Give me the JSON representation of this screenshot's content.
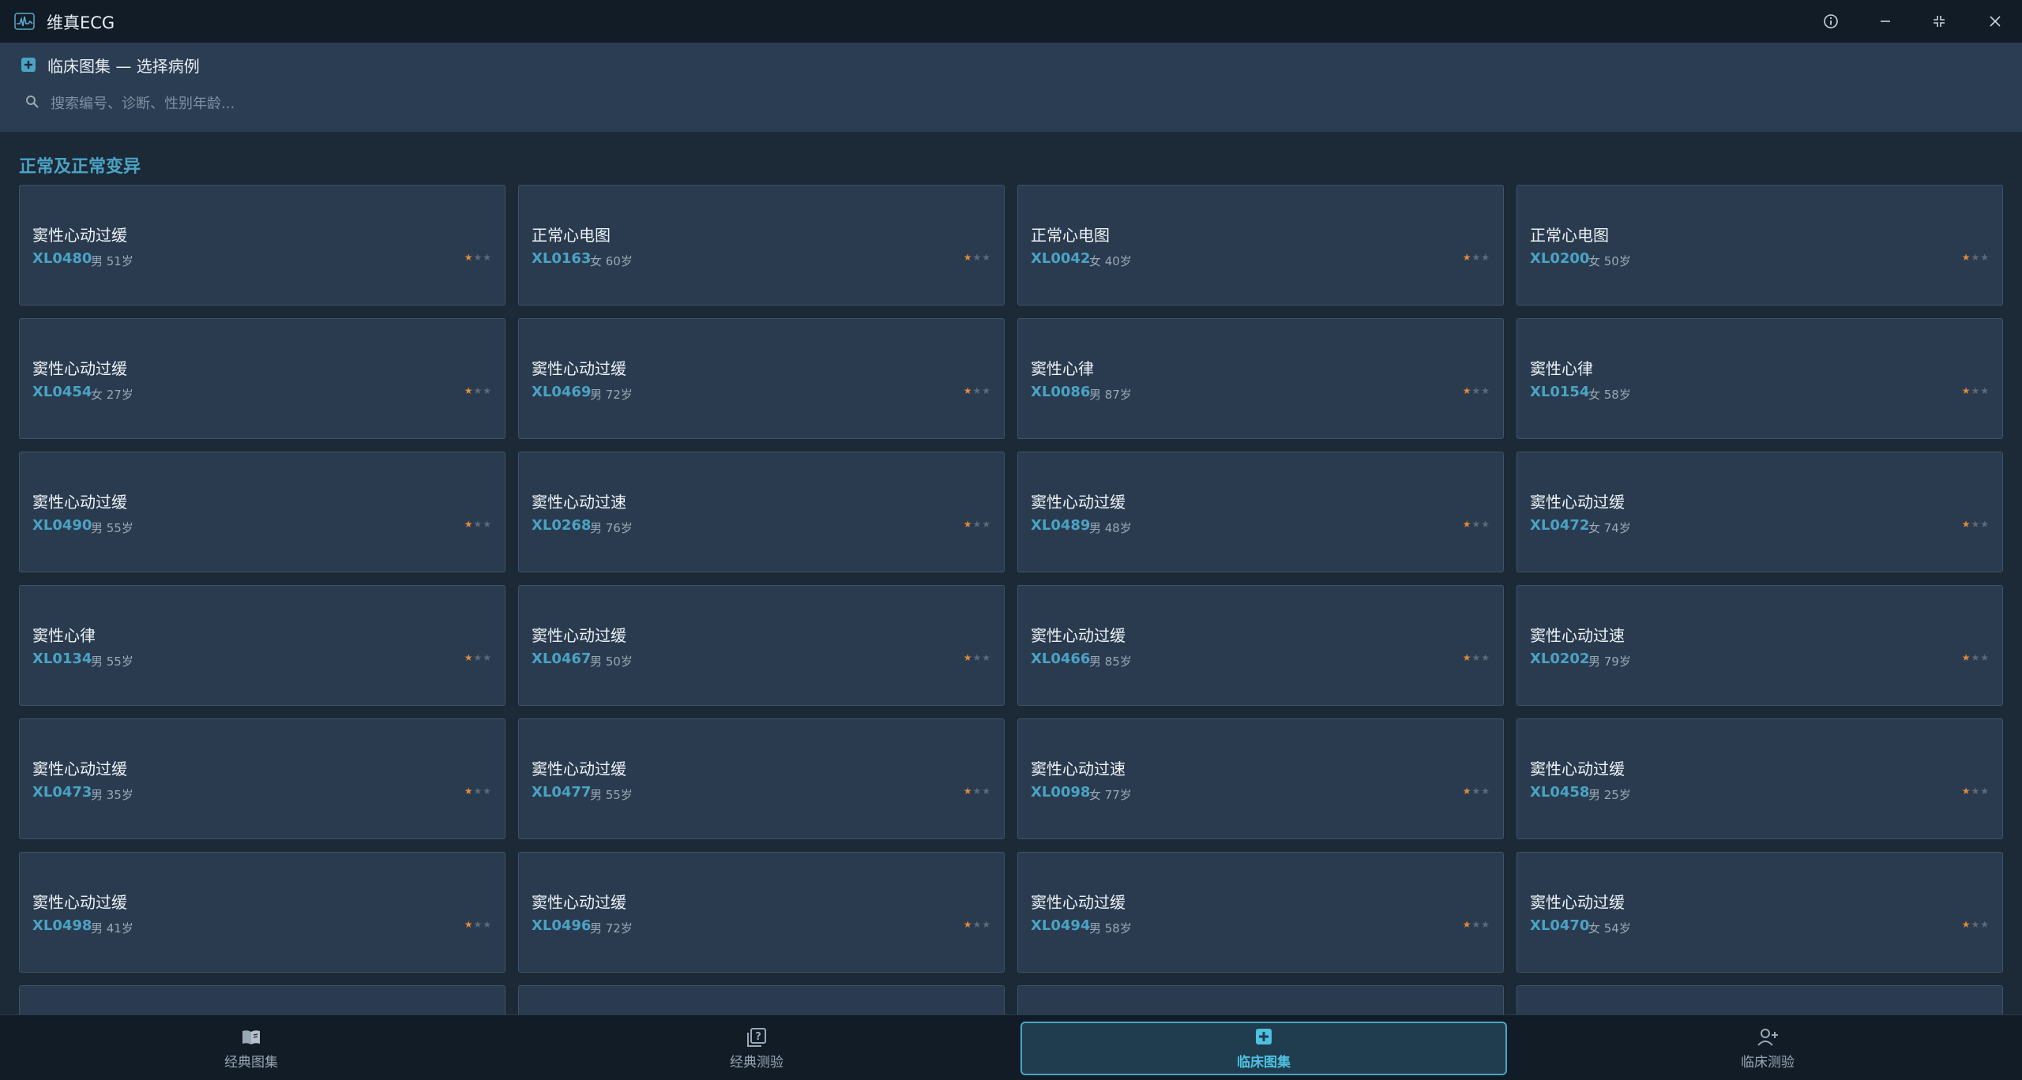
{
  "window": {
    "title": "维真ECG",
    "buttons": [
      "info-icon",
      "minimize-icon",
      "restore-icon",
      "close-icon"
    ]
  },
  "header": {
    "breadcrumb": "临床图集 — 选择病例",
    "search_placeholder": "搜索编号、诊断、性别年龄..."
  },
  "section": {
    "title": "正常及正常变异"
  },
  "cards": [
    {
      "title": "窦性心动过缓",
      "id": "XL0480",
      "meta": "男 51岁",
      "rating": 1
    },
    {
      "title": "正常心电图",
      "id": "XL0163",
      "meta": "女 60岁",
      "rating": 1
    },
    {
      "title": "正常心电图",
      "id": "XL0042",
      "meta": "女 40岁",
      "rating": 1
    },
    {
      "title": "正常心电图",
      "id": "XL0200",
      "meta": "女 50岁",
      "rating": 1
    },
    {
      "title": "窦性心动过缓",
      "id": "XL0454",
      "meta": "女 27岁",
      "rating": 1
    },
    {
      "title": "窦性心动过缓",
      "id": "XL0469",
      "meta": "男 72岁",
      "rating": 1
    },
    {
      "title": "窦性心律",
      "id": "XL0086",
      "meta": "男 87岁",
      "rating": 1
    },
    {
      "title": "窦性心律",
      "id": "XL0154",
      "meta": "女 58岁",
      "rating": 1
    },
    {
      "title": "窦性心动过缓",
      "id": "XL0490",
      "meta": "男 55岁",
      "rating": 1
    },
    {
      "title": "窦性心动过速",
      "id": "XL0268",
      "meta": "男 76岁",
      "rating": 1
    },
    {
      "title": "窦性心动过缓",
      "id": "XL0489",
      "meta": "男 48岁",
      "rating": 1
    },
    {
      "title": "窦性心动过缓",
      "id": "XL0472",
      "meta": "女 74岁",
      "rating": 1
    },
    {
      "title": "窦性心律",
      "id": "XL0134",
      "meta": "男 55岁",
      "rating": 1
    },
    {
      "title": "窦性心动过缓",
      "id": "XL0467",
      "meta": "男 50岁",
      "rating": 1
    },
    {
      "title": "窦性心动过缓",
      "id": "XL0466",
      "meta": "男 85岁",
      "rating": 1
    },
    {
      "title": "窦性心动过速",
      "id": "XL0202",
      "meta": "男 79岁",
      "rating": 1
    },
    {
      "title": "窦性心动过缓",
      "id": "XL0473",
      "meta": "男 35岁",
      "rating": 1
    },
    {
      "title": "窦性心动过缓",
      "id": "XL0477",
      "meta": "男 55岁",
      "rating": 1
    },
    {
      "title": "窦性心动过速",
      "id": "XL0098",
      "meta": "女 77岁",
      "rating": 1
    },
    {
      "title": "窦性心动过缓",
      "id": "XL0458",
      "meta": "男 25岁",
      "rating": 1
    },
    {
      "title": "窦性心动过缓",
      "id": "XL0498",
      "meta": "男 41岁",
      "rating": 1
    },
    {
      "title": "窦性心动过缓",
      "id": "XL0496",
      "meta": "男 72岁",
      "rating": 1
    },
    {
      "title": "窦性心动过缓",
      "id": "XL0494",
      "meta": "男 58岁",
      "rating": 1
    },
    {
      "title": "窦性心动过缓",
      "id": "XL0470",
      "meta": "女 54岁",
      "rating": 1
    }
  ],
  "rating_max": 3,
  "partial_cards_visible": 4,
  "bottom_nav": [
    {
      "label": "经典图集",
      "icon": "book-icon",
      "active": false
    },
    {
      "label": "经典测验",
      "icon": "quiz-icon",
      "active": false
    },
    {
      "label": "临床图集",
      "icon": "plus-square-icon",
      "active": true
    },
    {
      "label": "临床测验",
      "icon": "add-user-icon",
      "active": false
    }
  ],
  "colors": {
    "accent": "#4aa3c4",
    "star_on": "#e08b3a",
    "star_off": "#5b6b7b",
    "card_bg": "#2a3b4f",
    "page_bg": "#1c2937"
  }
}
